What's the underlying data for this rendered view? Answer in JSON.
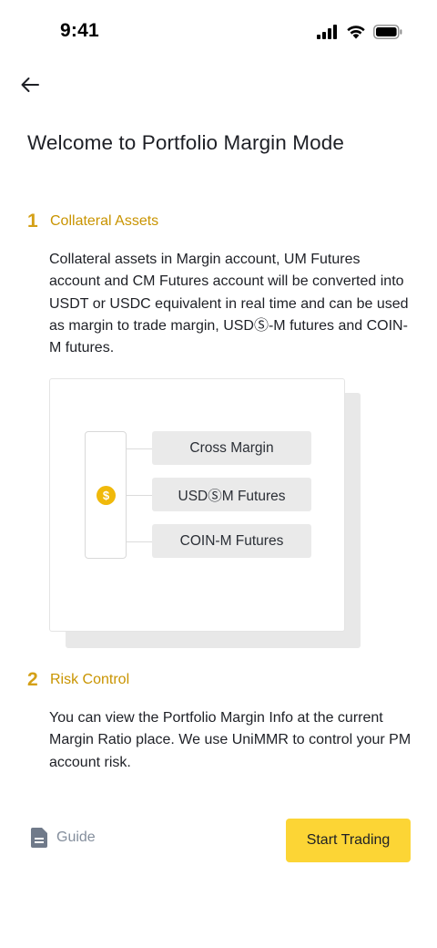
{
  "status_bar": {
    "time": "9:41",
    "icons": [
      "cellular-signal-icon",
      "wifi-icon",
      "battery-icon"
    ]
  },
  "header": {
    "back_icon": "arrow-left-icon"
  },
  "page": {
    "title": "Welcome to Portfolio Margin Mode"
  },
  "steps": [
    {
      "number": "1",
      "title": "Collateral Assets",
      "description": "Collateral assets in Margin account, UM Futures account and CM Futures account will be converted into USDT or USDC equivalent in real time and can be used as margin to trade margin, USDⓈ-M futures and COIN-M futures."
    },
    {
      "number": "2",
      "title": "Risk Control",
      "description": "You can view the Portfolio Margin Info at the current Margin Ratio place. We use UniMMR to control your PM account risk."
    }
  ],
  "illustration": {
    "source_icon": "dollar-coin-icon",
    "source_symbol": "$",
    "targets": [
      "Cross Margin",
      "USDⓈM Futures",
      "COIN-M Futures"
    ]
  },
  "footer": {
    "guide_icon": "document-icon",
    "guide_label": "Guide",
    "start_label": "Start Trading"
  },
  "colors": {
    "accent": "#f0b90b",
    "step_title": "#c99400",
    "button_bg": "#fcd535",
    "muted_text": "#848e9c"
  }
}
